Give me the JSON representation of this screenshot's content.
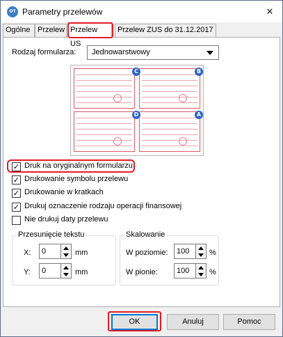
{
  "window": {
    "title": "Parametry przelewów",
    "icon_text": "OT"
  },
  "tabs": [
    {
      "label": "Ogólne"
    },
    {
      "label": "Przelew"
    },
    {
      "label": "Przelew US"
    },
    {
      "label": "Przelew ZUS do 31.12.2017"
    }
  ],
  "form_type": {
    "label": "Rodzaj formularza:",
    "value": "Jednowarstwowy"
  },
  "preview": {
    "badges": [
      "C",
      "B",
      "D",
      "A"
    ]
  },
  "checkboxes": [
    {
      "label": "Druk na oryginalnym formularzu",
      "checked": true
    },
    {
      "label": "Drukowanie symbolu przelewu",
      "checked": true
    },
    {
      "label": "Drukowanie w kratkach",
      "checked": true
    },
    {
      "label": "Drukuj oznaczenie rodzaju operacji finansowej",
      "checked": true
    },
    {
      "label": "Nie drukuj daty przelewu",
      "checked": false
    }
  ],
  "offset": {
    "title": "Przesunięcie tekstu",
    "x_label": "X:",
    "x_value": "0",
    "x_unit": "mm",
    "y_label": "Y:",
    "y_value": "0",
    "y_unit": "mm"
  },
  "scaling": {
    "title": "Skalowanie",
    "h_label": "W poziomie:",
    "h_value": "100",
    "h_unit": "%",
    "v_label": "W pionie:",
    "v_value": "100",
    "v_unit": "%"
  },
  "buttons": {
    "ok": "OK",
    "cancel": "Anuluj",
    "help": "Pomoc"
  },
  "colors": {
    "highlight": "#e31b23",
    "badge": "#2f63c8",
    "form_lines": "#e05a6a"
  }
}
